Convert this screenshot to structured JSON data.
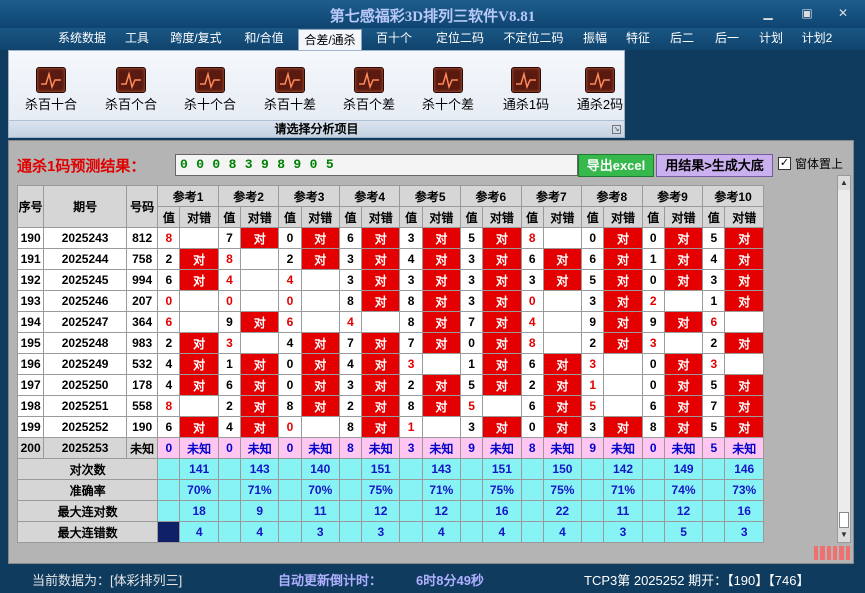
{
  "window": {
    "title": "第七感福彩3D排列三软件V8.81",
    "min": "▁",
    "restore": "▣",
    "close": "✕"
  },
  "menu": [
    "系统数据",
    "工具",
    "跨度/复式",
    "和/合值",
    "合差/通杀",
    "百十个",
    "定位二码",
    "不定位二码",
    "振幅",
    "特征",
    "后二",
    "后一",
    "计划",
    "计划2"
  ],
  "menu_active_index": 4,
  "ribbon": {
    "buttons": [
      "杀百十合",
      "杀百个合",
      "杀十个合",
      "杀百十差",
      "杀百个差",
      "杀十个差",
      "通杀1码",
      "通杀2码"
    ],
    "group_title": "请选择分析项目",
    "launcher": "↘"
  },
  "result": {
    "label": "通杀1码预测结果：",
    "value": "0 0 0 8 3 9 8 9 0 5",
    "export_button": "导出excel",
    "generate_button": "用结果>生成大底",
    "checkbox_checked": true,
    "checkbox_label": "窗体置上"
  },
  "table": {
    "headers_fixed": [
      "序号",
      "期号",
      "号码"
    ],
    "ref_headers": [
      "参考1",
      "参考2",
      "参考3",
      "参考4",
      "参考5",
      "参考6",
      "参考7",
      "参考8",
      "参考9",
      "参考10"
    ],
    "sub_value": "值",
    "sub_mark": "对错",
    "mark_text": "对",
    "rows": [
      {
        "seq": "190",
        "period": "2025243",
        "number": "812",
        "vals": [
          "8",
          "7",
          "0",
          "6",
          "3",
          "5",
          "8",
          "0",
          "0",
          "5"
        ],
        "hits": [
          0,
          1,
          1,
          1,
          1,
          1,
          0,
          1,
          1,
          1
        ]
      },
      {
        "seq": "191",
        "period": "2025244",
        "number": "758",
        "vals": [
          "2",
          "8",
          "2",
          "3",
          "4",
          "3",
          "6",
          "6",
          "1",
          "4"
        ],
        "hits": [
          1,
          0,
          1,
          1,
          1,
          1,
          1,
          1,
          1,
          1
        ]
      },
      {
        "seq": "192",
        "period": "2025245",
        "number": "994",
        "vals": [
          "6",
          "4",
          "4",
          "3",
          "3",
          "3",
          "3",
          "5",
          "0",
          "3"
        ],
        "hits": [
          1,
          0,
          0,
          1,
          1,
          1,
          1,
          1,
          1,
          1
        ]
      },
      {
        "seq": "193",
        "period": "2025246",
        "number": "207",
        "vals": [
          "0",
          "0",
          "0",
          "8",
          "8",
          "3",
          "0",
          "3",
          "2",
          "1"
        ],
        "hits": [
          0,
          0,
          0,
          1,
          1,
          1,
          0,
          1,
          0,
          1
        ]
      },
      {
        "seq": "194",
        "period": "2025247",
        "number": "364",
        "vals": [
          "6",
          "9",
          "6",
          "4",
          "8",
          "7",
          "4",
          "9",
          "9",
          "6"
        ],
        "hits": [
          0,
          1,
          0,
          0,
          1,
          1,
          0,
          1,
          1,
          0
        ]
      },
      {
        "seq": "195",
        "period": "2025248",
        "number": "983",
        "vals": [
          "2",
          "3",
          "4",
          "7",
          "7",
          "0",
          "8",
          "2",
          "3",
          "2"
        ],
        "hits": [
          1,
          0,
          1,
          1,
          1,
          1,
          0,
          1,
          0,
          1
        ]
      },
      {
        "seq": "196",
        "period": "2025249",
        "number": "532",
        "vals": [
          "4",
          "1",
          "0",
          "4",
          "3",
          "1",
          "6",
          "3",
          "0",
          "3"
        ],
        "hits": [
          1,
          1,
          1,
          1,
          0,
          1,
          1,
          0,
          1,
          0
        ]
      },
      {
        "seq": "197",
        "period": "2025250",
        "number": "178",
        "vals": [
          "4",
          "6",
          "0",
          "3",
          "2",
          "5",
          "2",
          "1",
          "0",
          "5"
        ],
        "hits": [
          1,
          1,
          1,
          1,
          1,
          1,
          1,
          0,
          1,
          1
        ]
      },
      {
        "seq": "198",
        "period": "2025251",
        "number": "558",
        "vals": [
          "8",
          "2",
          "8",
          "2",
          "8",
          "5",
          "6",
          "5",
          "6",
          "7"
        ],
        "hits": [
          0,
          1,
          1,
          1,
          1,
          0,
          1,
          0,
          1,
          1
        ]
      },
      {
        "seq": "199",
        "period": "2025252",
        "number": "190",
        "vals": [
          "6",
          "4",
          "0",
          "8",
          "1",
          "3",
          "0",
          "3",
          "8",
          "5"
        ],
        "hits": [
          1,
          1,
          0,
          1,
          0,
          1,
          1,
          1,
          1,
          1
        ]
      }
    ],
    "current": {
      "seq": "200",
      "period": "2025253",
      "number": "未知",
      "vals": [
        "0",
        "0",
        "0",
        "8",
        "3",
        "9",
        "8",
        "9",
        "0",
        "5"
      ],
      "mark": "未知"
    },
    "stats": [
      {
        "label": "对次数",
        "values": [
          "141",
          "143",
          "140",
          "151",
          "143",
          "151",
          "150",
          "142",
          "149",
          "146"
        ]
      },
      {
        "label": "准确率",
        "values": [
          "70%",
          "71%",
          "70%",
          "75%",
          "71%",
          "75%",
          "75%",
          "71%",
          "74%",
          "73%"
        ]
      },
      {
        "label": "最大连对数",
        "values": [
          "18",
          "9",
          "11",
          "12",
          "12",
          "16",
          "22",
          "11",
          "12",
          "16"
        ]
      },
      {
        "label": "最大连错数",
        "values": [
          "4",
          "4",
          "3",
          "3",
          "4",
          "4",
          "4",
          "3",
          "5",
          "3"
        ]
      }
    ]
  },
  "scroll": {
    "up": "▲",
    "down": "▼"
  },
  "status": {
    "data_label": "当前数据为：[体彩排列三]",
    "countdown_label": "自动更新倒计时：",
    "countdown_value": "6时8分49秒",
    "draw_info": "TCP3第 2025252 期开：【190】【746】"
  },
  "colors": {
    "hit": "#e40000",
    "current_row": "#ffc6f2",
    "stats": "#87f3f5",
    "accent_text": "#0000cc"
  }
}
